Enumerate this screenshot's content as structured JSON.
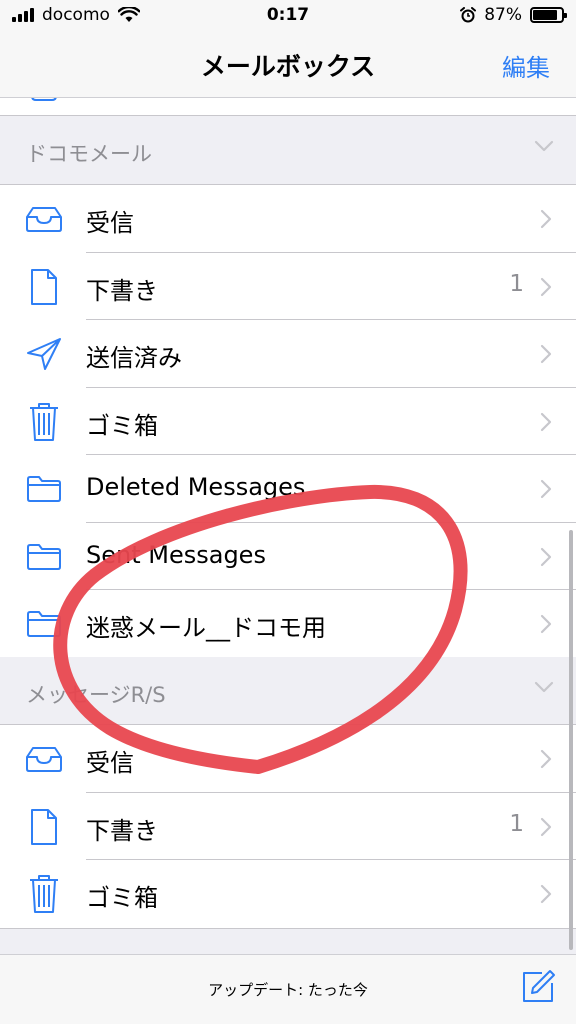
{
  "status_bar": {
    "carrier": "docomo",
    "time": "0:17",
    "battery": "87%",
    "battery_level": 0.87,
    "icons": [
      "signal-icon",
      "wifi-icon",
      "alarm-icon",
      "battery-icon"
    ]
  },
  "nav": {
    "title": "メールボックス",
    "edit_label": "編集"
  },
  "sections": [
    {
      "title": "ドコモメール",
      "items": [
        {
          "label": "受信",
          "icon": "inbox-icon",
          "count": ""
        },
        {
          "label": "下書き",
          "icon": "draft-icon",
          "count": "1"
        },
        {
          "label": "送信済み",
          "icon": "sent-icon",
          "count": ""
        },
        {
          "label": "ゴミ箱",
          "icon": "trash-icon",
          "count": ""
        },
        {
          "label": "Deleted Messages",
          "icon": "folder-icon",
          "count": ""
        },
        {
          "label": "Sent Messages",
          "icon": "folder-icon",
          "count": ""
        },
        {
          "label": "迷惑メール__ドコモ用",
          "icon": "folder-icon",
          "count": ""
        }
      ]
    },
    {
      "title": "メッセージR/S",
      "items": [
        {
          "label": "受信",
          "icon": "inbox-icon",
          "count": ""
        },
        {
          "label": "下書き",
          "icon": "draft-icon",
          "count": "1"
        },
        {
          "label": "ゴミ箱",
          "icon": "trash-icon",
          "count": ""
        }
      ]
    }
  ],
  "toolbar": {
    "status": "アップデート: たった今"
  },
  "colors": {
    "accent": "#2f7ff5",
    "annotation": "#e8474f",
    "background": "#efeff4"
  }
}
